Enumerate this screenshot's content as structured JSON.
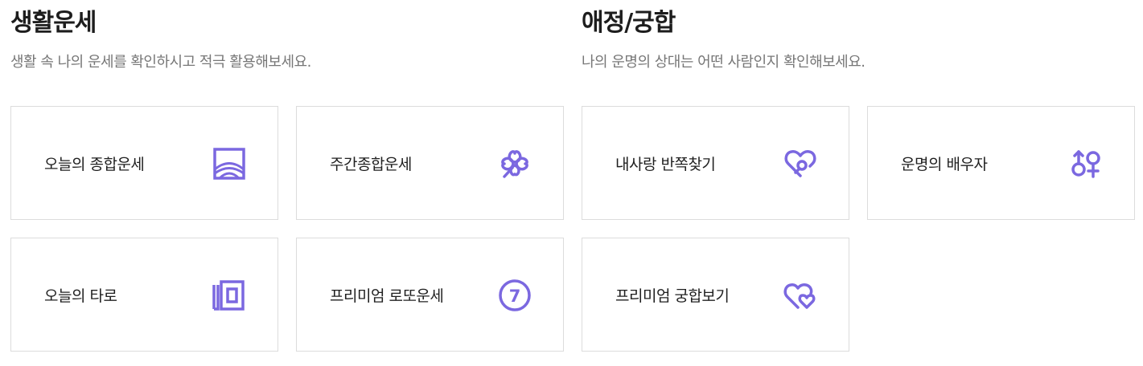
{
  "sections": {
    "life": {
      "title": "생활운세",
      "description": "생활 속 나의 운세를 확인하시고 적극 활용해보세요.",
      "items": [
        {
          "label": "오늘의 종합운세",
          "icon": "sunrise-window-icon"
        },
        {
          "label": "주간종합운세",
          "icon": "clover-icon"
        },
        {
          "label": "오늘의 타로",
          "icon": "tarot-cards-icon"
        },
        {
          "label": "프리미엄 로또운세",
          "icon": "lotto-ball-7-icon"
        }
      ]
    },
    "love": {
      "title": "애정/궁합",
      "description": "나의 운명의 상대는 어떤 사람인지 확인해보세요.",
      "items": [
        {
          "label": "내사랑 반쪽찾기",
          "icon": "heart-search-icon"
        },
        {
          "label": "운명의 배우자",
          "icon": "gender-symbols-icon"
        },
        {
          "label": "프리미엄 궁합보기",
          "icon": "double-heart-icon"
        }
      ]
    }
  },
  "colors": {
    "accent": "#7b68e0",
    "border": "#dcdcdc",
    "title": "#1d1d1d",
    "description": "#777777"
  },
  "icon_text": {
    "lotto_number": "7"
  }
}
